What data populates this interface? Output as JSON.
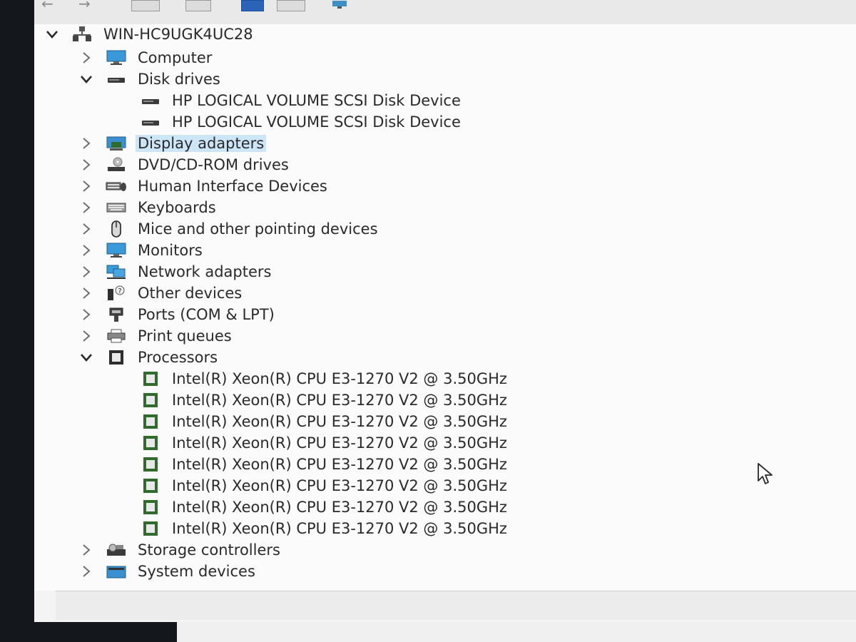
{
  "tree": {
    "root": {
      "label": "WIN-HC9UGK4UC28",
      "expanded": true
    },
    "categories": [
      {
        "label": "Computer",
        "icon": "monitor-icon",
        "expanded": false
      },
      {
        "label": "Disk drives",
        "icon": "disk-drive-icon",
        "expanded": true,
        "children": [
          "HP LOGICAL VOLUME SCSI Disk Device",
          "HP LOGICAL VOLUME SCSI Disk Device"
        ]
      },
      {
        "label": "Display adapters",
        "icon": "display-adapter-icon",
        "expanded": false,
        "selected": true
      },
      {
        "label": "DVD/CD-ROM drives",
        "icon": "dvd-drive-icon",
        "expanded": false
      },
      {
        "label": "Human Interface Devices",
        "icon": "hid-icon",
        "expanded": false
      },
      {
        "label": "Keyboards",
        "icon": "keyboard-icon",
        "expanded": false
      },
      {
        "label": "Mice and other pointing devices",
        "icon": "mouse-icon",
        "expanded": false
      },
      {
        "label": "Monitors",
        "icon": "monitor-icon",
        "expanded": false
      },
      {
        "label": "Network adapters",
        "icon": "network-adapter-icon",
        "expanded": false
      },
      {
        "label": "Other devices",
        "icon": "unknown-device-icon",
        "expanded": false
      },
      {
        "label": "Ports (COM & LPT)",
        "icon": "port-icon",
        "expanded": false
      },
      {
        "label": "Print queues",
        "icon": "printer-icon",
        "expanded": false
      },
      {
        "label": "Processors",
        "icon": "processor-icon",
        "expanded": true,
        "children": [
          "Intel(R) Xeon(R) CPU E3-1270 V2 @ 3.50GHz",
          "Intel(R) Xeon(R) CPU E3-1270 V2 @ 3.50GHz",
          "Intel(R) Xeon(R) CPU E3-1270 V2 @ 3.50GHz",
          "Intel(R) Xeon(R) CPU E3-1270 V2 @ 3.50GHz",
          "Intel(R) Xeon(R) CPU E3-1270 V2 @ 3.50GHz",
          "Intel(R) Xeon(R) CPU E3-1270 V2 @ 3.50GHz",
          "Intel(R) Xeon(R) CPU E3-1270 V2 @ 3.50GHz",
          "Intel(R) Xeon(R) CPU E3-1270 V2 @ 3.50GHz"
        ]
      },
      {
        "label": "Storage controllers",
        "icon": "storage-controller-icon",
        "expanded": false
      },
      {
        "label": "System devices",
        "icon": "system-devices-icon",
        "expanded": false
      }
    ]
  },
  "colors": {
    "selection": "#cde6f7",
    "processor_green": "#2f6b2a"
  }
}
